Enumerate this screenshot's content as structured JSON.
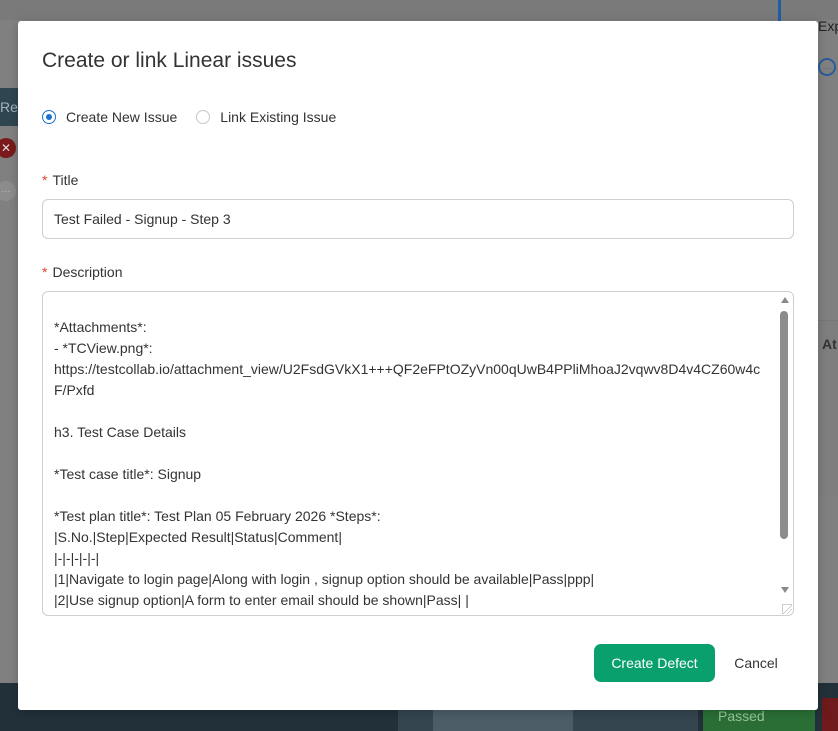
{
  "background": {
    "left_tab_label": "Res",
    "right_label": "Exp",
    "right_panel_label": "At",
    "status_button_label": "Passed"
  },
  "modal": {
    "title": "Create or link Linear issues",
    "radio_options": [
      {
        "label": "Create New Issue",
        "checked": true
      },
      {
        "label": "Link Existing Issue",
        "checked": false
      }
    ],
    "title_field": {
      "label": "Title",
      "value": "Test Failed - Signup - Step 3"
    },
    "description_field": {
      "label": "Description",
      "value": "*Attachments*:\n- *TCView.png*:\nhttps://testcollab.io/attachment_view/U2FsdGVkX1+++QF2eFPtOZyVn00qUwB4PPliMhoaJ2vqwv8D4v4CZ60w4cF/Pxfd\n\nh3. Test Case Details\n\n*Test case title*: Signup\n\n*Test plan title*: Test Plan 05 February 2026 *Steps*:\n|S.No.|Step|Expected Result|Status|Comment|\n|-|-|-|-|-|\n|1|Navigate to login page|Along with login , signup option should be available|Pass|ppp|\n|2|Use signup option|A form to enter email should be shown|Pass| |"
    },
    "buttons": {
      "create": "Create Defect",
      "cancel": "Cancel"
    }
  },
  "colors": {
    "primary": "#0aa06e",
    "radio_accent": "#1e6fd1",
    "required": "#e0452a"
  }
}
